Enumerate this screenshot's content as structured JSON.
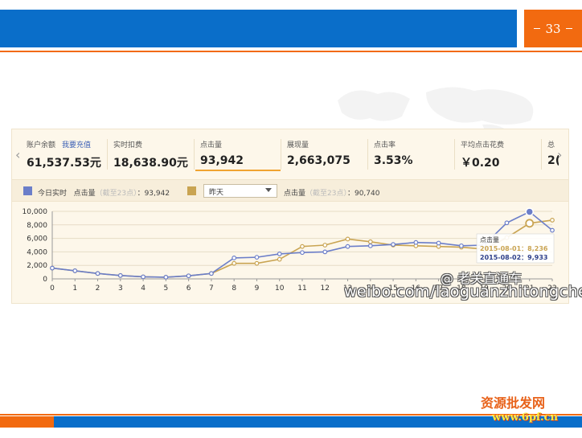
{
  "slide": {
    "page_number": "33"
  },
  "metrics": [
    {
      "label": "账户余额",
      "extra": "我要充值",
      "value": "61,537.53元"
    },
    {
      "label": "实时扣费",
      "value": "18,638.90元"
    },
    {
      "label": "点击量",
      "value": "93,942"
    },
    {
      "label": "展现量",
      "value": "2,663,075"
    },
    {
      "label": "点击率",
      "value": "3.53%"
    },
    {
      "label": "平均点击花费",
      "value": "￥0.20"
    },
    {
      "label": "总",
      "value": "2("
    }
  ],
  "legend": {
    "today_label": "今日实时",
    "today_metric": "点击量",
    "today_note": "（截至23点）",
    "today_value": "：93,942",
    "compare_select": "昨天",
    "compare_metric": "点击量",
    "compare_note": "（截至23点）",
    "compare_value": "：90,740"
  },
  "tooltip": {
    "title": "点击量",
    "line1": "2015-08-01：8,236",
    "line2": "2015-08-02：9,933"
  },
  "watermark": {
    "line1": "@ 老关直通车",
    "line2": "weibo.com/laoguanzhitongche"
  },
  "footer": {
    "logo": "资源批发网",
    "url": "www.6pf.cn"
  },
  "colors": {
    "today": "#6b7ec9",
    "yesterday": "#c9a452",
    "accent_orange": "#f26a10",
    "accent_blue": "#0a6ec9"
  },
  "chart_data": {
    "type": "line",
    "x": [
      0,
      1,
      2,
      3,
      4,
      5,
      6,
      7,
      8,
      9,
      10,
      11,
      12,
      13,
      14,
      15,
      16,
      17,
      18,
      19,
      20,
      21,
      22
    ],
    "xlim": [
      0,
      22
    ],
    "ylim": [
      0,
      10000
    ],
    "yticks": [
      "0",
      "2,000",
      "4,000",
      "6,000",
      "8,000",
      "10,000"
    ],
    "xticks": [
      "0",
      "1",
      "2",
      "3",
      "4",
      "5",
      "6",
      "7",
      "8",
      "9",
      "10",
      "11",
      "12",
      "13",
      "14",
      "15",
      "16",
      "17",
      "18",
      "19",
      "20",
      "21",
      "22"
    ],
    "grid": true,
    "series": [
      {
        "name": "今日实时",
        "color": "#6b7ec9",
        "values": [
          1600,
          1200,
          800,
          500,
          300,
          250,
          450,
          800,
          3100,
          3200,
          3700,
          3900,
          4000,
          4800,
          4900,
          5100,
          5400,
          5300,
          4900,
          5000,
          8300,
          9933,
          7200
        ]
      },
      {
        "name": "昨天",
        "color": "#c9a452",
        "values": [
          1600,
          1200,
          800,
          500,
          300,
          250,
          450,
          800,
          2300,
          2300,
          2900,
          4800,
          5000,
          5900,
          5500,
          5000,
          4900,
          4800,
          4700,
          4400,
          6100,
          8236,
          8700
        ]
      }
    ]
  }
}
